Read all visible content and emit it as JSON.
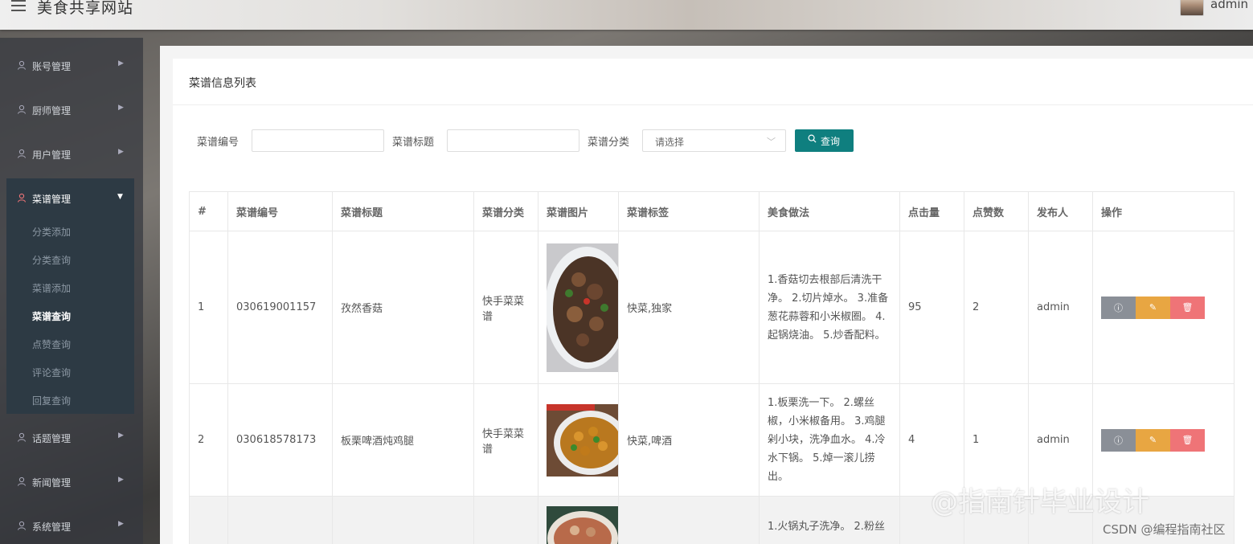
{
  "header": {
    "app_title": "美食共享网站",
    "user": "admin"
  },
  "sidebar": {
    "items_top": [
      {
        "label": "账号管理"
      },
      {
        "label": "厨师管理"
      },
      {
        "label": "用户管理"
      }
    ],
    "expanded_group": {
      "label": "菜谱管理",
      "children": [
        "分类添加",
        "分类查询",
        "菜谱添加",
        "菜谱查询",
        "点赞查询",
        "评论查询",
        "回复查询"
      ],
      "active_child": "菜谱查询"
    },
    "items_bottom": [
      {
        "label": "话题管理"
      },
      {
        "label": "新闻管理"
      },
      {
        "label": "系统管理"
      }
    ]
  },
  "panel": {
    "title": "菜谱信息列表",
    "filters": {
      "code_label": "菜谱编号",
      "code_value": "",
      "title_label": "菜谱标题",
      "title_value": "",
      "category_label": "菜谱分类",
      "category_placeholder": "请选择",
      "search_button": "查询"
    },
    "table": {
      "headers": [
        "#",
        "菜谱编号",
        "菜谱标题",
        "菜谱分类",
        "菜谱图片",
        "菜谱标签",
        "美食做法",
        "点击量",
        "点赞数",
        "发布人",
        "操作"
      ],
      "rows": [
        {
          "index": "1",
          "code": "030619001157",
          "title": "孜然香菇",
          "category": "快手菜菜谱",
          "image": "mushroom-dish",
          "tags": "快菜,独家",
          "method": "1.香菇切去根部后清洗干净。 2.切片焯水。 3.准备葱花蒜蓉和小米椒圈。 4.起锅烧油。 5.炒香配料。",
          "clicks": "95",
          "likes": "2",
          "publisher": "admin"
        },
        {
          "index": "2",
          "code": "030618578173",
          "title": "板栗啤酒炖鸡腿",
          "category": "快手菜菜谱",
          "image": "chestnut-chicken-dish",
          "tags": "快菜,啤酒",
          "method": "1.板栗洗一下。 2.螺丝椒，小米椒备用。 3.鸡腿剁小块，洗净血水。 4.冷水下锅。 5.焯一滚儿捞出。",
          "clicks": "4",
          "likes": "1",
          "publisher": "admin"
        },
        {
          "index": "",
          "code": "",
          "title": "",
          "category": "",
          "image": "hotpot-dish",
          "tags": "",
          "method": "1.火锅丸子洗净。 2.粉丝",
          "clicks": "",
          "likes": "",
          "publisher": ""
        }
      ]
    }
  },
  "watermarks": {
    "main": "@指南针毕业设计",
    "csdn": "CSDN @编程指南社区"
  },
  "colors": {
    "accent": "#0f7f7f",
    "view_button": "#8a8f97",
    "edit_button": "#e8a642",
    "delete_button": "#ef7477",
    "sidebar_active": "#2d3a44"
  },
  "icons": {
    "menu": "hamburger-icon",
    "user": "user-icon",
    "arrow": "caret-right-icon",
    "search": "search-icon",
    "info": "info-icon",
    "edit": "pencil-icon",
    "delete": "trash-icon"
  }
}
